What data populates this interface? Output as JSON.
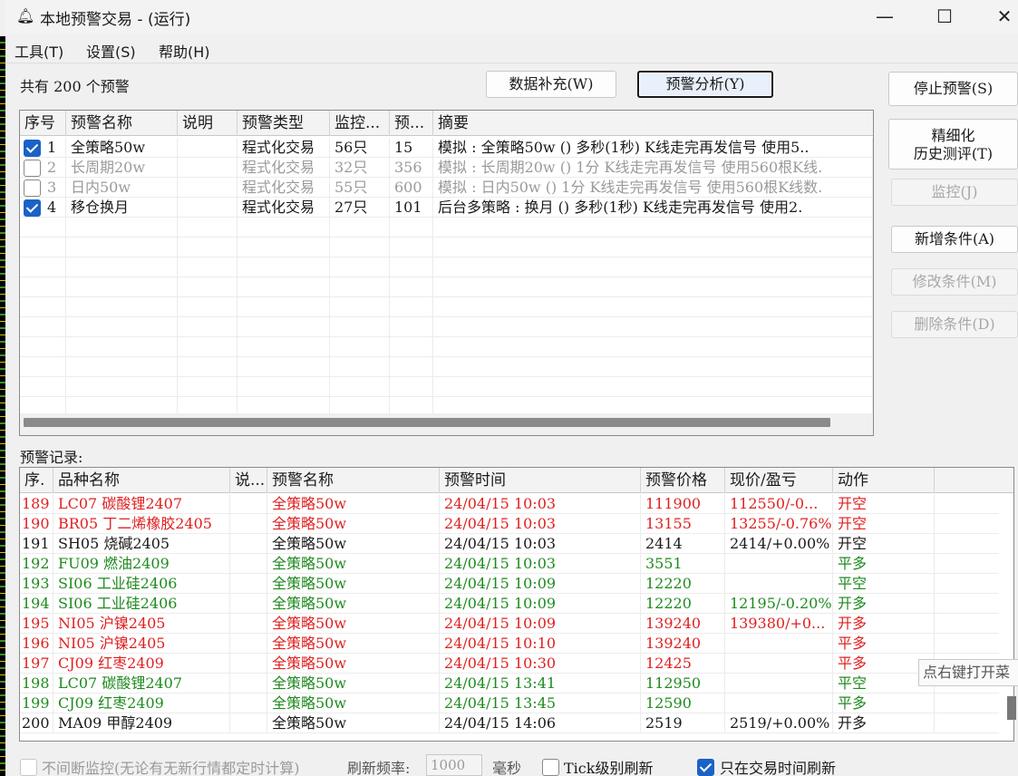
{
  "window": {
    "title": "本地预警交易 - (运行)",
    "app_icon": "bell-icon",
    "min_glyph": "—",
    "max_glyph": "☐",
    "close_glyph": "✕"
  },
  "menu": [
    "工具(T)",
    "设置(S)",
    "帮助(H)"
  ],
  "summary": {
    "prefix": "共有",
    "count": "200",
    "suffix": "个预警"
  },
  "buttons": {
    "data_fill": "数据补充(W)",
    "alert_analysis": "预警分析(Y)",
    "stop_alert": "停止预警(S)",
    "backtest_line1": "精细化",
    "backtest_line2": "历史测评(T)",
    "monitor": "监控(J)",
    "add_condition": "新增条件(A)",
    "edit_condition": "修改条件(M)",
    "delete_condition": "删除条件(D)"
  },
  "alerts_table": {
    "columns": [
      "序号",
      "预警名称",
      "说明",
      "预警类型",
      "监控...",
      "预...",
      "摘要"
    ],
    "rows": [
      {
        "checked": true,
        "no": "1",
        "name": "全策略50w",
        "desc": "",
        "type": "程式化交易",
        "monitor": "56只",
        "pre": "15",
        "summary": "模拟 : 全策略50w () 多秒(1秒) K线走完再发信号 使用5.."
      },
      {
        "checked": false,
        "no": "2",
        "name": "长周期20w",
        "desc": "",
        "type": "程式化交易",
        "monitor": "32只",
        "pre": "356",
        "summary": "模拟 : 长周期20w () 1分 K线走完再发信号 使用560根K线."
      },
      {
        "checked": false,
        "no": "3",
        "name": "日内50w",
        "desc": "",
        "type": "程式化交易",
        "monitor": "55只",
        "pre": "600",
        "summary": "模拟 : 日内50w () 1分 K线走完再发信号 使用560根K线数."
      },
      {
        "checked": true,
        "no": "4",
        "name": "移仓换月",
        "desc": "",
        "type": "程式化交易",
        "monitor": "27只",
        "pre": "101",
        "summary": "后台多策略 : 换月 () 多秒(1秒) K线走完再发信号 使用2."
      }
    ]
  },
  "records_label": "预警记录:",
  "records_table": {
    "columns": [
      "序.",
      "品种名称",
      "说...",
      "预警名称",
      "预警时间",
      "预警价格",
      "现价/盈亏",
      "动作"
    ],
    "rows": [
      {
        "color": "red",
        "no": "189",
        "product": "LC07 碳酸锂2407",
        "desc": "",
        "name": "全策略50w",
        "time": "24/04/15 10:03",
        "price": "111900",
        "current": "112550/-0...",
        "action": "开空"
      },
      {
        "color": "red",
        "no": "190",
        "product": "BR05 丁二烯橡胶2405",
        "desc": "",
        "name": "全策略50w",
        "time": "24/04/15 10:03",
        "price": "13155",
        "current": "13255/-0.76%",
        "action": "开空"
      },
      {
        "color": "black",
        "no": "191",
        "product": "SH05 烧碱2405",
        "desc": "",
        "name": "全策略50w",
        "time": "24/04/15 10:03",
        "price": "2414",
        "current": "2414/+0.00%",
        "action": "开空"
      },
      {
        "color": "green",
        "no": "192",
        "product": "FU09 燃油2409",
        "desc": "",
        "name": "全策略50w",
        "time": "24/04/15 10:03",
        "price": "3551",
        "current": "",
        "action": "平多"
      },
      {
        "color": "green",
        "no": "193",
        "product": "SI06 工业硅2406",
        "desc": "",
        "name": "全策略50w",
        "time": "24/04/15 10:09",
        "price": "12220",
        "current": "",
        "action": "平空"
      },
      {
        "color": "green",
        "no": "194",
        "product": "SI06 工业硅2406",
        "desc": "",
        "name": "全策略50w",
        "time": "24/04/15 10:09",
        "price": "12220",
        "current": "12195/-0.20%",
        "action": "开多"
      },
      {
        "color": "red",
        "no": "195",
        "product": "NI05 沪镍2405",
        "desc": "",
        "name": "全策略50w",
        "time": "24/04/15 10:09",
        "price": "139240",
        "current": "139380/+0...",
        "action": "开多"
      },
      {
        "color": "red",
        "no": "196",
        "product": "NI05 沪镍2405",
        "desc": "",
        "name": "全策略50w",
        "time": "24/04/15 10:10",
        "price": "139240",
        "current": "",
        "action": "平多"
      },
      {
        "color": "red",
        "no": "197",
        "product": "CJ09 红枣2409",
        "desc": "",
        "name": "全策略50w",
        "time": "24/04/15 10:30",
        "price": "12425",
        "current": "",
        "action": "平多"
      },
      {
        "color": "green",
        "no": "198",
        "product": "LC07 碳酸锂2407",
        "desc": "",
        "name": "全策略50w",
        "time": "24/04/15 13:41",
        "price": "112950",
        "current": "",
        "action": "平空"
      },
      {
        "color": "green",
        "no": "199",
        "product": "CJ09 红枣2409",
        "desc": "",
        "name": "全策略50w",
        "time": "24/04/15 13:45",
        "price": "12590",
        "current": "",
        "action": "平多"
      },
      {
        "color": "black",
        "no": "200",
        "product": "MA09 甲醇2409",
        "desc": "",
        "name": "全策略50w",
        "time": "24/04/15 14:06",
        "price": "2519",
        "current": "2519/+0.00%",
        "action": "开多"
      }
    ]
  },
  "tooltip": "点右键打开菜",
  "options": {
    "continuous_label": "不间断监控(无论有无新行情都定时计算)",
    "continuous_checked": false,
    "freq_label": "刷新频率:",
    "freq_value": "1000",
    "freq_unit": "毫秒",
    "tick_label": "Tick级别刷新",
    "tick_checked": false,
    "trading_only_label": "只在交易时间刷新",
    "trading_only_checked": true
  }
}
